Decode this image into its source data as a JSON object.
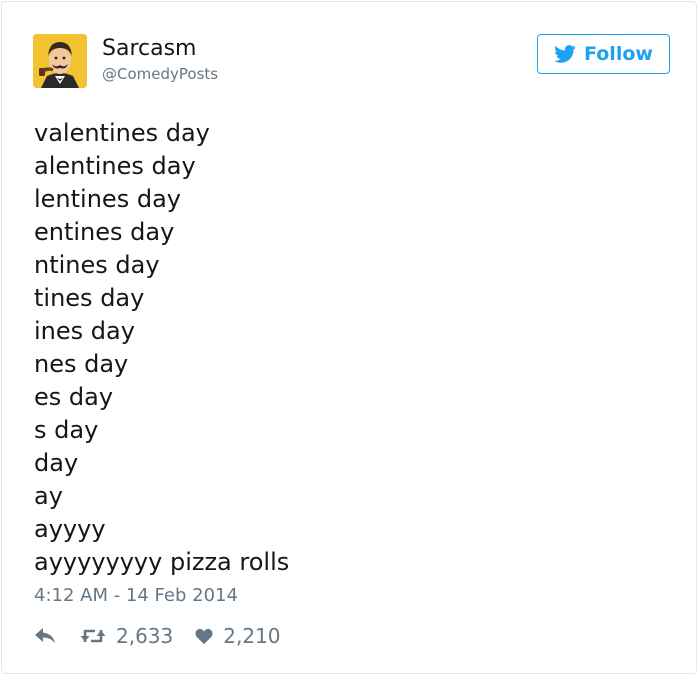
{
  "author": {
    "name": "Sarcasm",
    "handle": "@ComedyPosts"
  },
  "follow_button": {
    "label": "Follow",
    "icon": "twitter-bird-icon"
  },
  "tweet": {
    "lines": [
      "valentines day",
      "alentines day",
      "lentines day",
      "entines day",
      "ntines day",
      "tines day",
      "ines day",
      "nes day",
      "es day",
      "s day",
      "day",
      "ay",
      "ayyyy",
      "ayyyyyyyy pizza rolls"
    ],
    "timestamp": "4:12 AM - 14 Feb 2014"
  },
  "actions": {
    "reply_icon": "reply-icon",
    "retweet_icon": "retweet-icon",
    "retweet_count": "2,633",
    "like_icon": "heart-icon",
    "like_count": "2,210"
  },
  "colors": {
    "accent": "#1da1f2",
    "text": "#14171a",
    "muted": "#657786",
    "border": "#e1e8ed"
  }
}
